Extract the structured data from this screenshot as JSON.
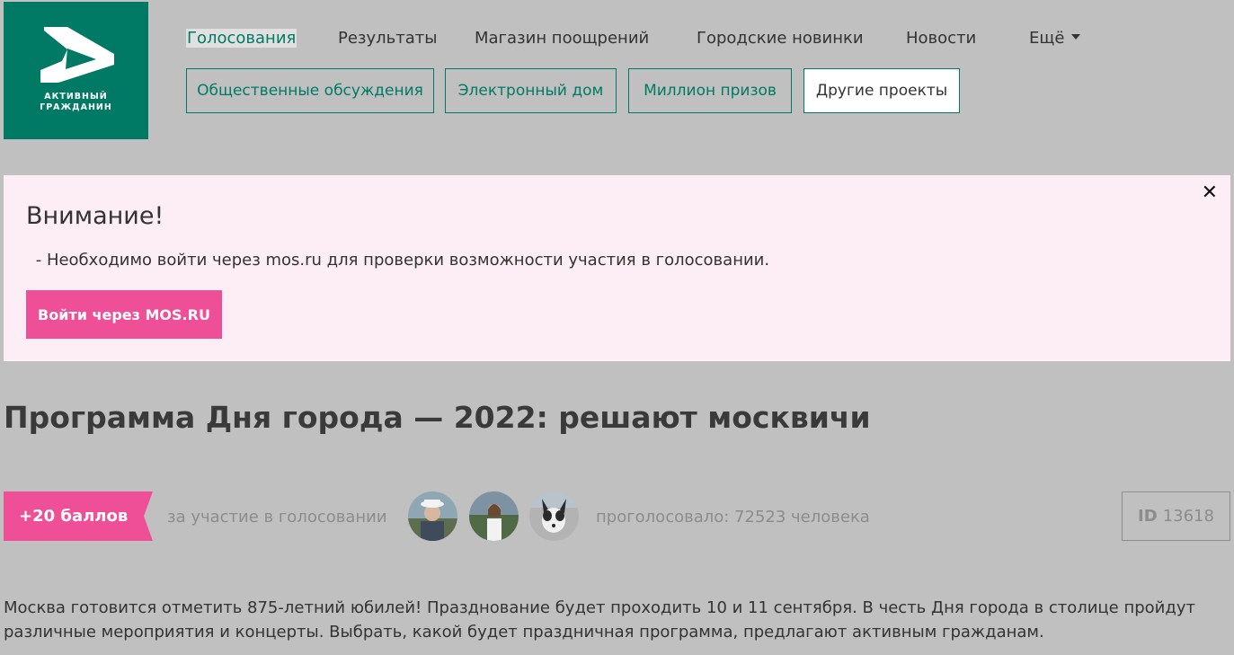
{
  "logo": {
    "line1": "АКТИВНЫЙ",
    "line2": "ГРАЖДАНИН",
    "icon": "letter-a-logo-icon"
  },
  "nav": {
    "items": [
      "Голосования",
      "Результаты",
      "Магазин поощрений",
      "Городские новинки",
      "Новости",
      "Ещё"
    ],
    "more_icon": "caret-down-icon"
  },
  "subnav": [
    "Общественные обсуждения",
    "Электронный дом",
    "Миллион призов",
    "Другие проекты"
  ],
  "alert": {
    "close_icon": "close-icon",
    "close_glyph": "✕",
    "title": "Внимание!",
    "text": " - Необходимо войти через mos.ru для проверки возможности участия в голосовании.",
    "button": "Войти через MOS.RU"
  },
  "poll": {
    "title": "Программа Дня города — 2022: решают москвичи",
    "points": "+20 баллов",
    "points_caption": "за участие в голосовании",
    "voted": "проголосовало: 72523 человека",
    "id_label": "ID",
    "id_value": "13618",
    "description": "Москва готовится отметить 875-летний юбилей! Празднование будет проходить 10 и 11 сентября. В честь Дня города в столице пройдут различные мероприятия и концерты. Выбрать, какой будет праздничная программа, предлагают активным гражданам."
  },
  "colors": {
    "brand_green": "#007a65",
    "accent_pink": "#ef4f96",
    "alert_bg": "#fdedf4"
  }
}
